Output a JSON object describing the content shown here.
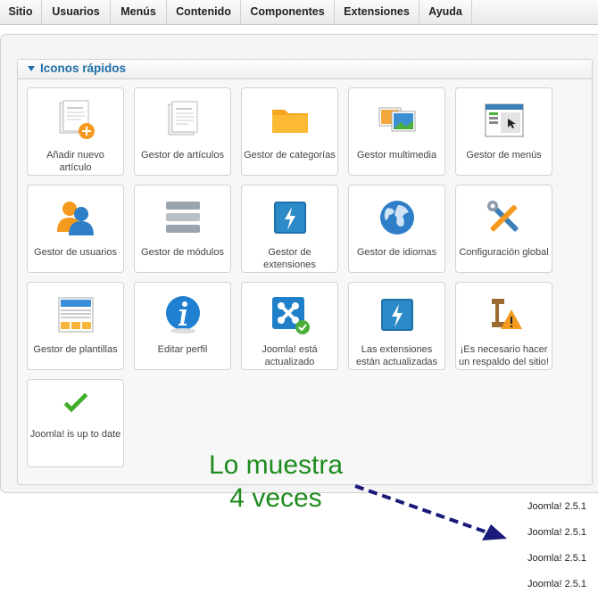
{
  "menu": [
    "Sitio",
    "Usuarios",
    "Menús",
    "Contenido",
    "Componentes",
    "Extensiones",
    "Ayuda"
  ],
  "panel": {
    "title": "Iconos rápidos"
  },
  "tiles": [
    {
      "label": "Añadir nuevo artículo",
      "icon": "add-article-icon"
    },
    {
      "label": "Gestor de artículos",
      "icon": "article-manager-icon"
    },
    {
      "label": "Gestor de categorías",
      "icon": "folder-icon"
    },
    {
      "label": "Gestor multimedia",
      "icon": "media-icon"
    },
    {
      "label": "Gestor de menús",
      "icon": "menu-manager-icon"
    },
    {
      "label": "Gestor de usuarios",
      "icon": "users-icon"
    },
    {
      "label": "Gestor de módulos",
      "icon": "modules-icon"
    },
    {
      "label": "Gestor de extensiones",
      "icon": "extensions-icon"
    },
    {
      "label": "Gestor de idiomas",
      "icon": "globe-icon"
    },
    {
      "label": "Configuración global",
      "icon": "tools-icon"
    },
    {
      "label": "Gestor de plantillas",
      "icon": "templates-icon"
    },
    {
      "label": "Editar perfil",
      "icon": "info-icon"
    },
    {
      "label": "Joomla! está actualizado",
      "icon": "joomla-check-icon"
    },
    {
      "label": "Las extensiones están actualizadas",
      "icon": "extensions-update-icon"
    },
    {
      "label": "¡Es necesario hacer un respaldo del sitio!",
      "icon": "backup-warning-icon"
    },
    {
      "label": "Joomla! is up to date",
      "icon": "checkmark-icon"
    }
  ],
  "annotation": {
    "line1": "Lo muestra",
    "line2": "4 veces"
  },
  "versions": [
    "Joomla! 2.5.1",
    "Joomla! 2.5.1",
    "Joomla! 2.5.1",
    "Joomla! 2.5.1"
  ],
  "colors": {
    "accent": "#1f6fa8",
    "annotation": "#1e8b1e",
    "arrow": "#1a1a7a"
  }
}
